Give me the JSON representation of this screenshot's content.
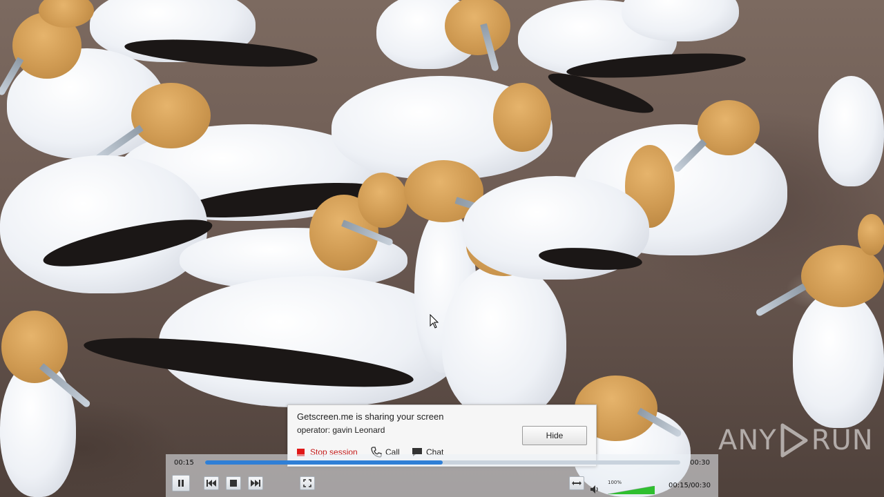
{
  "popup": {
    "title": "Getscreen.me is sharing your screen",
    "operator": "operator: gavin Leonard",
    "hide_label": "Hide",
    "stop_label": "Stop session",
    "call_label": "Call",
    "chat_label": "Chat"
  },
  "player": {
    "current_time": "00:15",
    "total_time": "00:30",
    "position_fraction": 0.5,
    "volume_label": "100%",
    "volume_fraction": 1.0,
    "time_readout": "00:15/00:30",
    "buttons": [
      "pause-icon",
      "previous-icon",
      "stop-icon",
      "next-icon",
      "fullscreen-icon",
      "stretch-icon",
      "speaker-icon"
    ]
  },
  "watermark": {
    "text_a": "ANY",
    "text_b": "RUN"
  },
  "colors": {
    "accent": "#2f7fd6",
    "stop": "#e01818",
    "volume": "#2fbf2f"
  }
}
